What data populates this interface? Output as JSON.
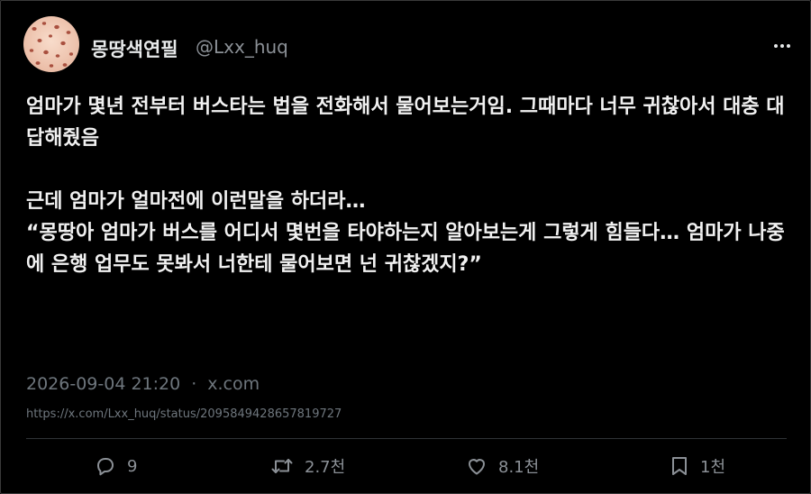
{
  "user": {
    "display_name": "몽땅색연필",
    "handle": "@Lxx_huq"
  },
  "tweet": {
    "lines": [
      "엄마가 몇년 전부터 버스타는 법을 전화해서 물어보는거임. 그때마다 너무 귀찮아서 대충 대답해줬음",
      "",
      "근데 엄마가 얼마전에 이런말을 하더라…",
      "“몽땅아 엄마가 버스를 어디서 몇번을 타야하는지 알아보는게 그렇게 힘들다… 엄마가 나중에 은행 업무도 못봐서 너한테 물어보면 넌 귀찮겠지?”"
    ]
  },
  "meta": {
    "timestamp": "2026-09-04 21:20",
    "separator": "·",
    "source": "x.com",
    "url": "https://x.com/Lxx_huq/status/2095849428657819727"
  },
  "actions": {
    "reply_count": "9",
    "retweet_count": "2.7천",
    "like_count": "8.1천",
    "bookmark_count": "1천"
  },
  "icons": {
    "more": "more-horizontal-icon",
    "reply": "reply-icon",
    "retweet": "retweet-icon",
    "like": "heart-icon",
    "bookmark": "bookmark-icon"
  },
  "colors": {
    "background": "#000000",
    "text": "#e7e9ea",
    "secondary": "#6e767d",
    "avatar_bg": "#f3cdb9",
    "avatar_spots": "#b45a4a"
  }
}
